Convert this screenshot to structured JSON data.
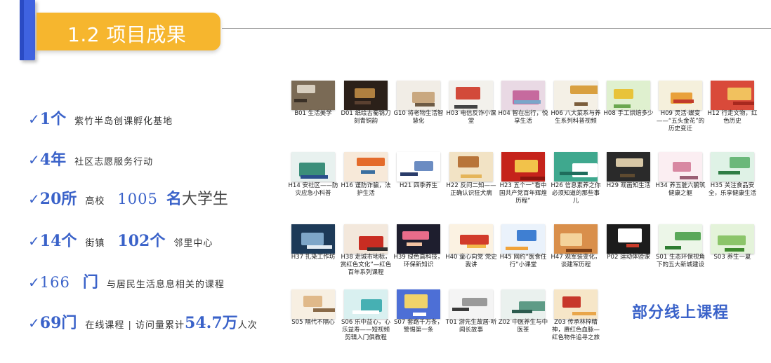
{
  "header": {
    "title": "1.2 项目成果"
  },
  "stats": {
    "s1": {
      "check": "✓",
      "num": "1个",
      "text": "紫竹半岛创课孵化基地"
    },
    "s2": {
      "check": "✓",
      "num": "4年",
      "text": "社区志愿服务行动"
    },
    "s3": {
      "check": "✓",
      "num": "20所",
      "text1": "高校",
      "num2": "1005",
      "num3": "名",
      "text2": "大学生"
    },
    "s4": {
      "check": "✓",
      "num": "14个",
      "text1": "街镇",
      "num2": "102个",
      "text2": "邻里中心"
    },
    "s5": {
      "check": "✓",
      "num": "166",
      "num2": "门",
      "text": "与居民生活息息相关的课程"
    },
    "s6": {
      "check": "✓",
      "num": "69门",
      "text1": "在线课程 | 访问量累计",
      "num2": "54.7万",
      "text2": "人次"
    }
  },
  "courses": [
    {
      "caption": "B01 生活美学",
      "c1": "#7a6a55",
      "c2": "#d8cfc0",
      "c3": "#3a3026"
    },
    {
      "caption": "D01 纸绘古蜀锦刀刻青铜韵",
      "c1": "#2b2019",
      "c2": "#b08040",
      "c3": "#5a4030"
    },
    {
      "caption": "G10 将老物生活智慧化",
      "c1": "#f1ede6",
      "c2": "#c9a880",
      "c3": "#6d5a44"
    },
    {
      "caption": "H03 电信反诈小课堂",
      "c1": "#f3f1ec",
      "c2": "#d24a3a",
      "c3": "#444444"
    },
    {
      "caption": "H04 智在出行，悦享生活",
      "c1": "#e9d9e4",
      "c2": "#c66a9e",
      "c3": "#7aa6c9"
    },
    {
      "caption": "H06 八大菜系与养生系列科普视频",
      "c1": "#f4f0e6",
      "c2": "#d9a040",
      "c3": "#7b5d3b"
    },
    {
      "caption": "H08 手工烘焙多少",
      "c1": "#dff0cf",
      "c2": "#e8c33a",
      "c3": "#6aa84f"
    },
    {
      "caption": "H09 灵活·蝶变——“五头金花”的历史变迁",
      "c1": "#f5f0dc",
      "c2": "#e9a13b",
      "c3": "#c23b2a"
    },
    {
      "caption": "H12 行走文物，红色历史",
      "c1": "#d94a3a",
      "c2": "#f1c15e",
      "c3": "#a8281e"
    },
    {
      "caption": "H14 安社区——防灾应急小科普",
      "c1": "#e8f1ef",
      "c2": "#3b8e7a",
      "c3": "#2a4e8c"
    },
    {
      "caption": "H16 谨防诈骗，法护生活",
      "c1": "#f7e9d9",
      "c2": "#e46b2b",
      "c3": "#3a6fa0"
    },
    {
      "caption": "H21 四季养生",
      "c1": "#ffffff",
      "c2": "#6b8cc2",
      "c3": "#2a3c6a"
    },
    {
      "caption": "H22 反问二知——正确认识狂犬病",
      "c1": "#f2e3c5",
      "c2": "#b8753a",
      "c3": "#e5b55a"
    },
    {
      "caption": "H23 五个一“看中国共产党百年辉煌历程”",
      "c1": "#c5231b",
      "c2": "#f2c24a",
      "c3": "#8a150f"
    },
    {
      "caption": "H26 信息素养之你必须知道的那些事儿",
      "c1": "#3fa88e",
      "c2": "#ffffff",
      "c3": "#1f6d5c"
    },
    {
      "caption": "H29 观画知生活",
      "c1": "#2a2a2a",
      "c2": "#d7c7a6",
      "c3": "#5e4a30"
    },
    {
      "caption": "H34 养五脏六腑筑健康之躯",
      "c1": "#fbeef2",
      "c2": "#d888a2",
      "c3": "#9a5f74"
    },
    {
      "caption": "H35 关注食品安全，乐享健康生活",
      "c1": "#dff2e6",
      "c2": "#6bb87a",
      "c3": "#2f7d45"
    },
    {
      "caption": "H37 扎染工作坊",
      "c1": "#1d3a58",
      "c2": "#7ea6c8",
      "c3": "#e4ecf3"
    },
    {
      "caption": "H38 走城市地标，赏红色文化”—红色百年系列课程",
      "c1": "#f3e8dc",
      "c2": "#c92d22",
      "c3": "#333333"
    },
    {
      "caption": "H39 绿色高科技，环保新知识",
      "c1": "#1e1e2e",
      "c2": "#e86c8a",
      "c3": "#f3c3a2"
    },
    {
      "caption": "H40 童心向党 党史我讲",
      "c1": "#fbf2e2",
      "c2": "#d23b2a",
      "c3": "#f1b84a"
    },
    {
      "caption": "H45 网约“医食住行”小课堂",
      "c1": "#eaf2fb",
      "c2": "#3f7fd2",
      "c3": "#f0a33a"
    },
    {
      "caption": "H47 观军装变化，谈建军历程",
      "c1": "#d98f4b",
      "c2": "#f4d39b",
      "c3": "#7a3e16"
    },
    {
      "caption": "P02 运动体验课",
      "c1": "#1c1c1c",
      "c2": "#ffffff",
      "c3": "#c93b2a"
    },
    {
      "caption": "S01 生态环保视角下的五大新城建设",
      "c1": "#ecf6e8",
      "c2": "#5aa85a",
      "c3": "#2e7d32"
    },
    {
      "caption": "S03 养生一夏",
      "c1": "#e4f3da",
      "c2": "#8cc56a",
      "c3": "#3f8a2f"
    },
    {
      "caption": "S05 隔代不隔心",
      "c1": "#f7efe2",
      "c2": "#e0b98a",
      "c3": "#8a6a48"
    },
    {
      "caption": "S06 乐中益心，心乐益寿——短视频剪辑入门俱教程",
      "c1": "#d9f0f0",
      "c2": "#46b0b3",
      "c3": "#ffffff"
    },
    {
      "caption": "S07 套路千万条，警惕第一条",
      "c1": "#4d6fd6",
      "c2": "#f1d36a",
      "c3": "#ffffff"
    },
    {
      "caption": "T01 游先生故居·听闻长故事",
      "c1": "#f4f4f4",
      "c2": "#9a9a9a",
      "c3": "#3a3a3a"
    },
    {
      "caption": "Z02 中医养生与中医茶",
      "c1": "#eaf1ee",
      "c2": "#5e9b86",
      "c3": "#2b5b4e"
    },
    {
      "caption": "Z03 传承林梓精神，赓红色血脉—红色物件追寻之旅",
      "c1": "#f6e6c8",
      "c2": "#c7372a",
      "c3": "#e9a64a"
    }
  ],
  "online_label": "部分线上课程"
}
